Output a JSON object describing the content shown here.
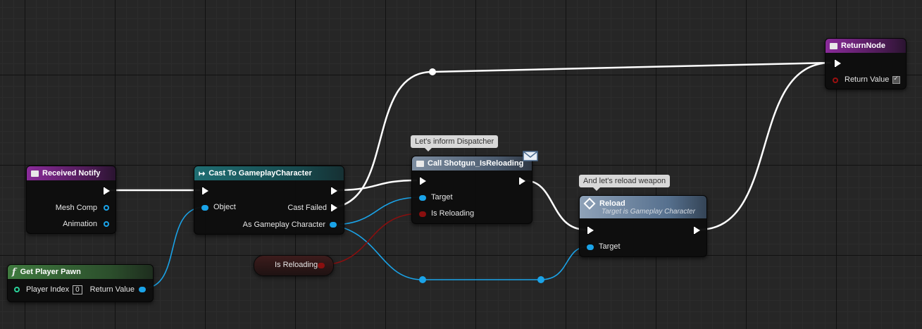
{
  "comments": {
    "dispatcher": "Let's inform Dispatcher",
    "reload": "And let's reload weapon"
  },
  "nodes": {
    "received_notify": {
      "title": "Received Notify",
      "pins": {
        "mesh_comp": "Mesh Comp",
        "animation": "Animation"
      }
    },
    "get_player_pawn": {
      "title": "Get Player Pawn",
      "pins": {
        "player_index": "Player Index",
        "player_index_value": "0",
        "return_value": "Return Value"
      }
    },
    "cast": {
      "title": "Cast To GameplayCharacter",
      "pins": {
        "object": "Object",
        "cast_failed": "Cast Failed",
        "as_gameplay_character": "As Gameplay Character"
      }
    },
    "call_dispatcher": {
      "title": "Call Shotgun_IsReloading",
      "pins": {
        "target": "Target",
        "is_reloading": "Is Reloading"
      }
    },
    "is_reloading_var": {
      "label": "Is Reloading"
    },
    "reload": {
      "title": "Reload",
      "subtitle": "Target is Gameplay Character",
      "pins": {
        "target": "Target"
      }
    },
    "return_node": {
      "title": "ReturnNode",
      "pins": {
        "return_value": "Return Value"
      },
      "return_value_checked": true
    }
  },
  "colors": {
    "exec_wire": "#ffffff",
    "object_wire": "#1aa3e8",
    "bool_wire": "#8a0f0f",
    "event_header": "#8a2b9a",
    "cast_header": "#1f6e73",
    "function_header": "#3f7a3f",
    "call_header": "#7d8da0",
    "reload_header": "#8fa2b8"
  },
  "icons": {
    "event": "event-icon",
    "cast": "cast-arrow-icon",
    "function": "function-f-icon",
    "call": "call-icon",
    "reload": "diamond-icon",
    "message": "envelope-icon",
    "return": "return-icon"
  }
}
